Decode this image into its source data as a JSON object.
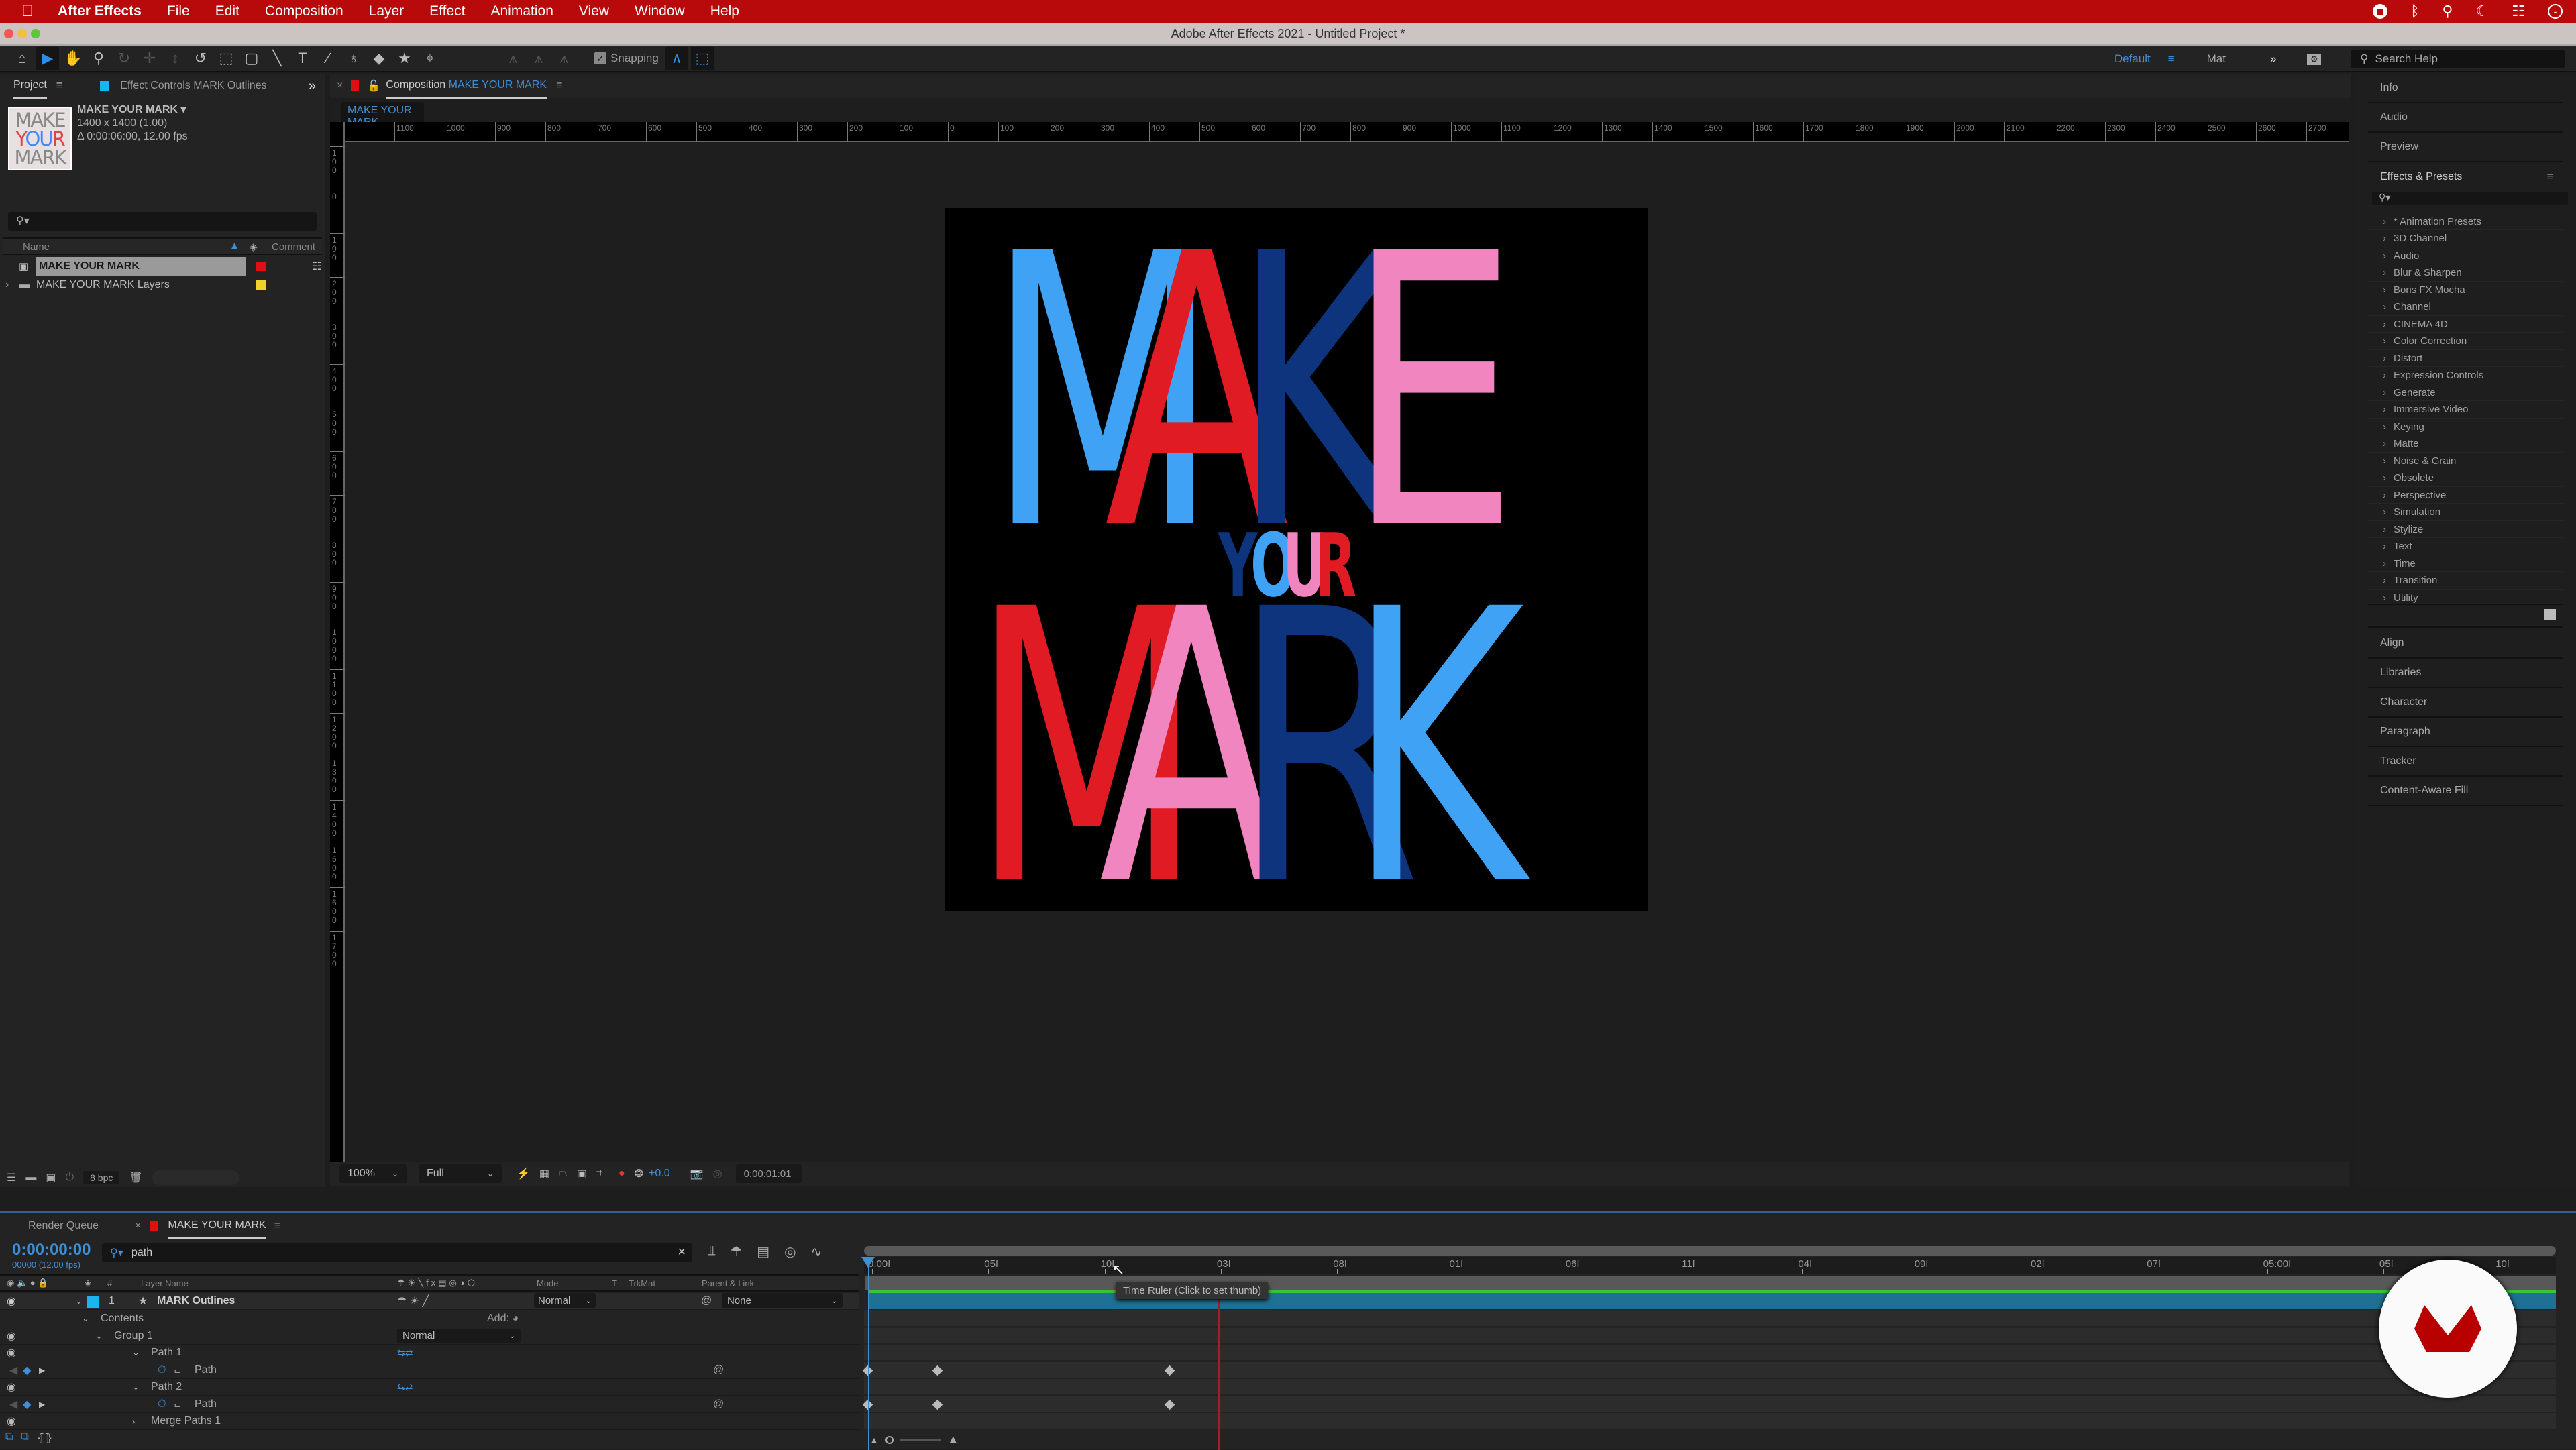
{
  "menubar": {
    "app_name": "After Effects",
    "items": [
      "File",
      "Edit",
      "Composition",
      "Layer",
      "Effect",
      "Animation",
      "View",
      "Window",
      "Help"
    ],
    "status_icons": [
      "screen-record-icon",
      "bluetooth-icon",
      "spotlight-search-icon",
      "do-not-disturb-icon",
      "control-center-icon",
      "user-icon"
    ]
  },
  "window": {
    "title": "Adobe After Effects 2021 - Untitled Project *"
  },
  "toolbar": {
    "snapping_label": "Snapping",
    "snapping_checked": true,
    "workspace_active": "Default",
    "workspace_other": "Mat",
    "search_help_placeholder": "Search Help"
  },
  "project_panel": {
    "tab_label": "Project",
    "effect_controls_tab": "Effect Controls MARK Outlines",
    "comp_name": "MAKE YOUR MARK",
    "comp_dims": "1400 x 1400 (1.00)",
    "comp_duration": "Δ 0:00:06:00, 12.00 fps",
    "columns": {
      "name": "Name",
      "comment": "Comment"
    },
    "items": [
      {
        "name": "MAKE YOUR MARK",
        "type": "composition",
        "label_color": "#e01010",
        "selected": true
      },
      {
        "name": "MAKE YOUR MARK Layers",
        "type": "folder",
        "label_color": "#f2d02a",
        "selected": false
      }
    ],
    "bit_depth": "8 bpc"
  },
  "composition_panel": {
    "tab_prefix": "Composition",
    "tab_name": "MAKE YOUR MARK",
    "breadcrumb": "MAKE YOUR MARK",
    "hruler_labels": [
      "1100",
      "1000",
      "900",
      "800",
      "700",
      "600",
      "500",
      "400",
      "300",
      "200",
      "100",
      "0",
      "100",
      "200",
      "300",
      "400",
      "500",
      "600",
      "700",
      "800",
      "900",
      "1000",
      "1100",
      "1200",
      "1300",
      "1400",
      "1500",
      "1600",
      "1700",
      "1800",
      "1900",
      "2000",
      "2100",
      "2200",
      "2300",
      "2400",
      "2500",
      "2600",
      "2700"
    ],
    "vruler_labels": [
      "100",
      "0",
      "100",
      "200",
      "300",
      "400",
      "500",
      "600",
      "700",
      "800",
      "900",
      "1000",
      "1100",
      "1200",
      "1300",
      "1400",
      "1500",
      "1600",
      "1700"
    ],
    "artwork": {
      "line1": [
        {
          "ch": "M",
          "color": "#3fa2f5"
        },
        {
          "ch": "A",
          "color": "#e01b24"
        },
        {
          "ch": "K",
          "color": "#0e347e"
        },
        {
          "ch": "E",
          "color": "#f085c0"
        }
      ],
      "line2": [
        {
          "ch": "Y",
          "color": "#0e347e"
        },
        {
          "ch": "O",
          "color": "#3fa2f5"
        },
        {
          "ch": "U",
          "color": "#f085c0"
        },
        {
          "ch": "R",
          "color": "#e01b24"
        }
      ],
      "line3": [
        {
          "ch": "M",
          "color": "#e01b24"
        },
        {
          "ch": "A",
          "color": "#f085c0"
        },
        {
          "ch": "R",
          "color": "#0e347e"
        },
        {
          "ch": "K",
          "color": "#3fa2f5"
        }
      ]
    },
    "zoom": "100%",
    "resolution": "Full",
    "exposure": "+0.0",
    "current_time": "0:00:01:01"
  },
  "right_panel": {
    "top_items": [
      "Info",
      "Audio",
      "Preview"
    ],
    "effects_title": "Effects & Presets",
    "effects_categories": [
      "* Animation Presets",
      "3D Channel",
      "Audio",
      "Blur & Sharpen",
      "Boris FX Mocha",
      "Channel",
      "CINEMA 4D",
      "Color Correction",
      "Distort",
      "Expression Controls",
      "Generate",
      "Immersive Video",
      "Keying",
      "Matte",
      "Noise & Grain",
      "Obsolete",
      "Perspective",
      "Simulation",
      "Stylize",
      "Text",
      "Time",
      "Transition",
      "Utility"
    ],
    "bottom_items": [
      "Align",
      "Libraries",
      "Character",
      "Paragraph",
      "Tracker",
      "Content-Aware Fill"
    ]
  },
  "timeline": {
    "render_queue_tab": "Render Queue",
    "comp_tab": "MAKE YOUR MARK",
    "timecode": "0:00:00:00",
    "frame_info": "00000 (12.00 fps)",
    "search_value": "path",
    "columns": {
      "num": "#",
      "layer_name": "Layer Name",
      "mode": "Mode",
      "t": "T",
      "trkmat": "TrkMat",
      "parent": "Parent & Link"
    },
    "layer": {
      "index": "1",
      "name": "MARK Outlines",
      "label_color": "#1ab4f0",
      "mode": "Normal",
      "parent": "None"
    },
    "tree": [
      {
        "label": "Contents",
        "depth": 1,
        "extra": "Add:"
      },
      {
        "label": "Group 1",
        "depth": 2,
        "mode": "Normal"
      },
      {
        "label": "Path 1",
        "depth": 3
      },
      {
        "label": "Path",
        "depth": 4,
        "property": true
      },
      {
        "label": "Path 2",
        "depth": 3
      },
      {
        "label": "Path",
        "depth": 4,
        "property": true
      },
      {
        "label": "Merge Paths 1",
        "depth": 3,
        "collapsed": true
      }
    ],
    "ruler_ticks": [
      "0:00f",
      "05f",
      "10f",
      "03f",
      "08f",
      "01f",
      "06f",
      "11f",
      "04f",
      "09f",
      "02f",
      "07f",
      "05:00f",
      "05f",
      "10f"
    ],
    "keyframes_frames": [
      0,
      3,
      13
    ],
    "tooltip": "Time Ruler (Click to set thumb)"
  }
}
